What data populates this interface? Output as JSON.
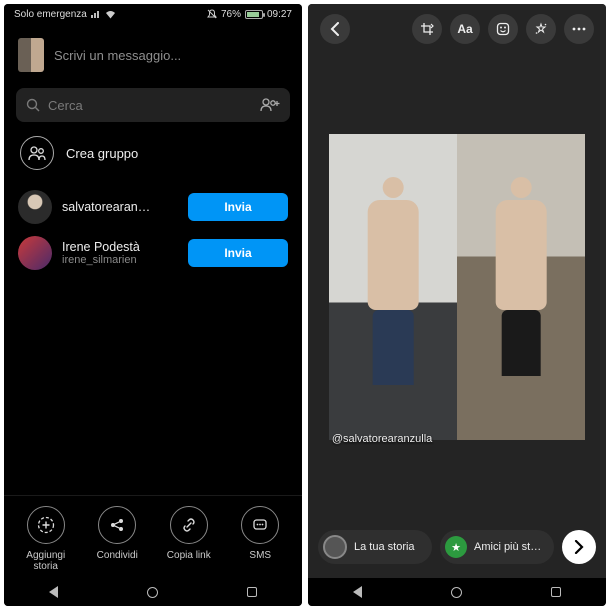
{
  "statusbar": {
    "carrier": "Solo emergenza",
    "battery_pct": "76%",
    "time": "09:27"
  },
  "compose": {
    "placeholder": "Scrivi un messaggio..."
  },
  "search": {
    "placeholder": "Cerca"
  },
  "group": {
    "label": "Crea gruppo"
  },
  "contacts": [
    {
      "name": "salvatorearan…",
      "username": "",
      "button": "Invia"
    },
    {
      "name": "Irene Podestà",
      "username": "irene_silmarien",
      "button": "Invia"
    }
  ],
  "bottom_actions": [
    {
      "label": "Aggiungi storia"
    },
    {
      "label": "Condividi"
    },
    {
      "label": "Copia link"
    },
    {
      "label": "SMS"
    }
  ],
  "editor": {
    "mention": "@salvatorearanzulla",
    "pills": [
      {
        "label": "La tua storia"
      },
      {
        "label": "Amici più st…"
      }
    ]
  }
}
